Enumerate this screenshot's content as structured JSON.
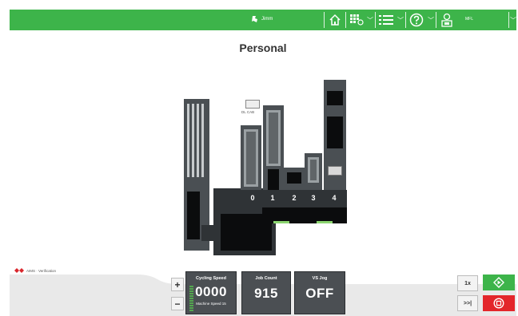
{
  "topbar": {
    "user_name": "Jimm",
    "status_text": "MFL",
    "icons": [
      "home-icon",
      "job-settings-icon",
      "menu-list-icon",
      "help-icon",
      "machine-status-icon"
    ]
  },
  "page": {
    "title": "Personal"
  },
  "machine": {
    "feeder_labels": [
      "0",
      "1",
      "2",
      "3",
      "4"
    ],
    "tray_label": "DL CAB"
  },
  "footer": {
    "brand_text": "AIMS · Verification",
    "plus_label": "+",
    "minus_label": "−",
    "cycling": {
      "label": "Cycling Speed",
      "value": "0000",
      "sub": "Machine Speed 15"
    },
    "job_count": {
      "label": "Job Count",
      "value": "915"
    },
    "vs_jog": {
      "label": "VS Jog",
      "value": "OFF"
    },
    "btn_1x": "1x",
    "btn_step": ">>|"
  },
  "colors": {
    "topbar": "#3db44a",
    "go": "#3db44a",
    "stop": "#e3262b"
  }
}
